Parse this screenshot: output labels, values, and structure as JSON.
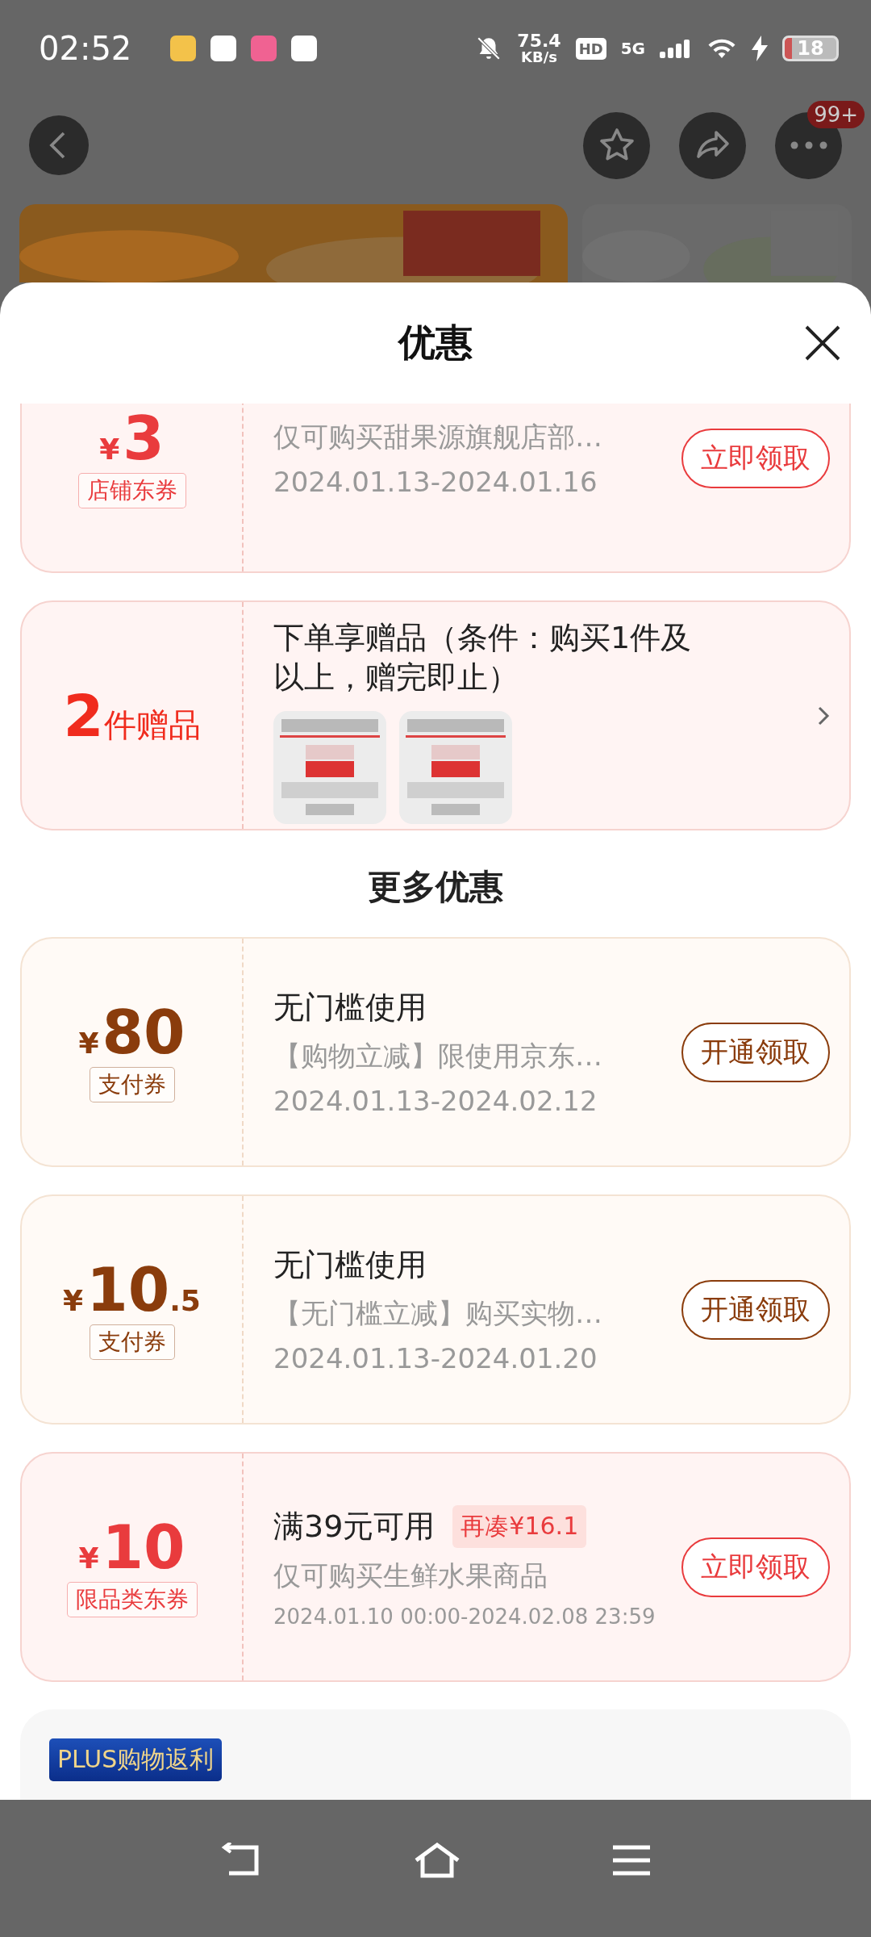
{
  "status_bar": {
    "time": "02:52",
    "speed": "75.4",
    "speed_unit": "KB/s",
    "hd": "HD",
    "network": "5G",
    "battery": "18"
  },
  "header": {
    "badge": "99+"
  },
  "sheet": {
    "title": "优惠"
  },
  "coupons": [
    {
      "currency": "¥",
      "amount": "3",
      "tag": "店铺东券",
      "desc": "仅可购买甜果源旗舰店部…",
      "date": "2024.01.13-2024.01.16",
      "button": "立即领取",
      "color": "#e93b3d",
      "cut": true
    }
  ],
  "gift": {
    "count": "2",
    "unit": "件赠品",
    "title": "下单享赠品（条件：购买1件及以上，赠完即止）"
  },
  "more": {
    "title": "更多优惠",
    "coupons": [
      {
        "currency": "¥",
        "amount": "80",
        "tag": "支付券",
        "title": "无门槛使用",
        "desc": "【购物立减】限使用京东…",
        "date": "2024.01.13-2024.02.12",
        "button": "开通领取",
        "color": "#8a3c0c"
      },
      {
        "currency": "¥",
        "amount": "10",
        "fraction": ".5",
        "tag": "支付券",
        "title": "无门槛使用",
        "desc": "【无门槛立减】购买实物…",
        "date": "2024.01.13-2024.01.20",
        "button": "开通领取",
        "color": "#8a3c0c"
      },
      {
        "currency": "¥",
        "amount": "10",
        "tag": "限品类东券",
        "title": "满39元可用",
        "badge": "再凑¥16.1",
        "desc": "仅可购买生鲜水果商品",
        "date": "2024.01.10 00:00-2024.02.08 23:59",
        "small_date": true,
        "button": "立即领取",
        "color": "#e93b3d"
      }
    ]
  },
  "plus": {
    "tag": "PLUS购物返利"
  }
}
